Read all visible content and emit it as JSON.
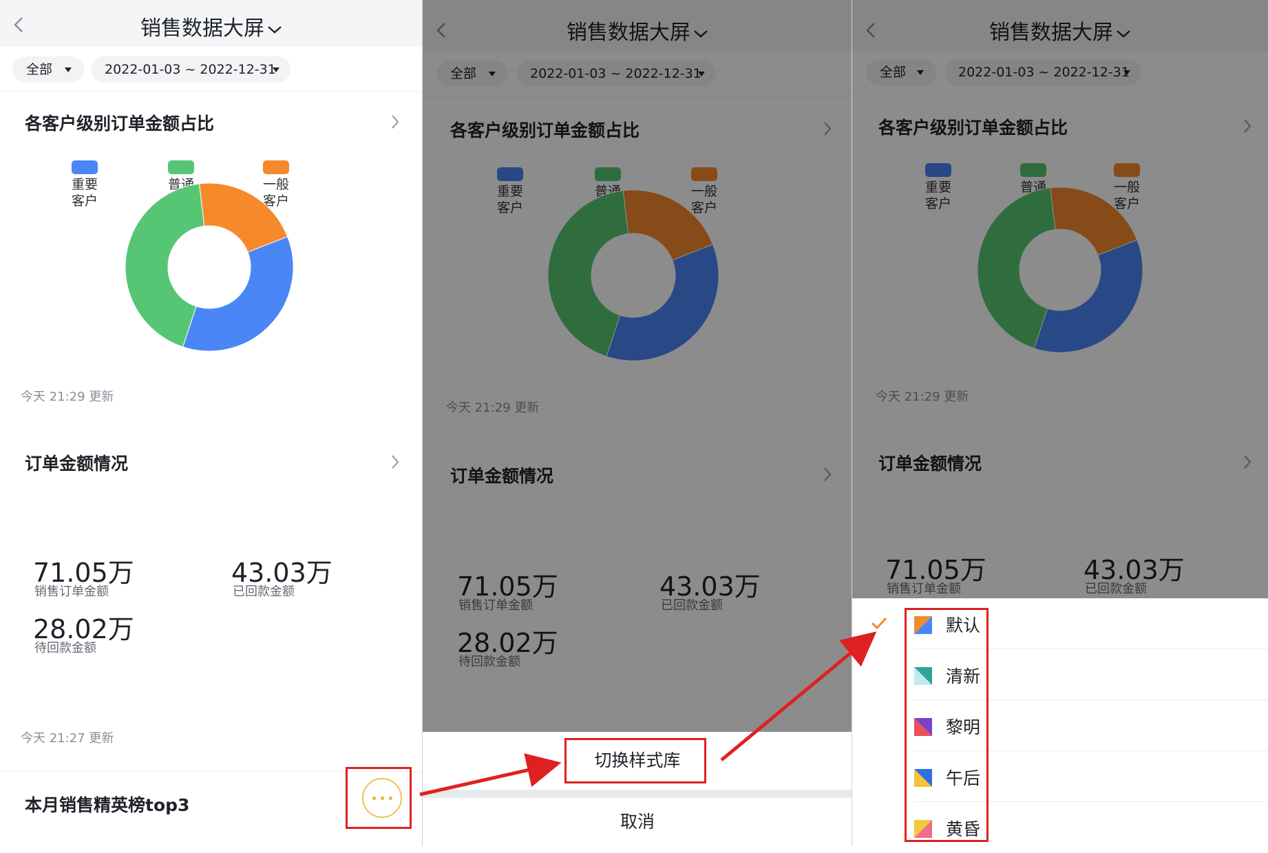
{
  "app": {
    "title": "销售数据大屏",
    "filter_scope": "全部",
    "filter_date_range": "2022-01-03 ~ 2022-12-31"
  },
  "cards": {
    "share": {
      "title": "各客户级别订单金额占比",
      "updated": "今天 21:29 更新"
    },
    "orders": {
      "title": "订单金额情况",
      "updated": "今天 21:27 更新",
      "metrics": [
        {
          "value": "71.05万",
          "label": "销售订单金额"
        },
        {
          "value": "43.03万",
          "label": "已回款金额"
        },
        {
          "value": "28.02万",
          "label": "待回款金额"
        }
      ]
    },
    "top3": {
      "title": "本月销售精英榜top3"
    }
  },
  "chart_data": {
    "type": "pie",
    "categories": [
      "重要客户",
      "普通客户",
      "一般客户"
    ],
    "values": [
      36,
      43,
      21
    ],
    "colors": [
      "#4a86f5",
      "#56c674",
      "#f5892c"
    ],
    "dark_colors": [
      "#1f3f8c",
      "#266a3c",
      "#8a4310"
    ],
    "legend_position": "top",
    "donut": true
  },
  "sheet": {
    "switch_style": "切换样式库",
    "cancel": "取消"
  },
  "styles": {
    "selected": "默认",
    "items": [
      {
        "label": "默认",
        "colors": [
          "#f5892c",
          "#4a86f5"
        ]
      },
      {
        "label": "清新",
        "colors": [
          "#2fa39a",
          "#bfeaf0"
        ]
      },
      {
        "label": "黎明",
        "colors": [
          "#7a42c9",
          "#ee4f5a"
        ]
      },
      {
        "label": "午后",
        "colors": [
          "#2f6fe0",
          "#f6c23a"
        ]
      },
      {
        "label": "黄昏",
        "colors": [
          "#f1c93a",
          "#f06c8a"
        ]
      }
    ]
  },
  "icons": {
    "back": "back-chevron-icon",
    "more": "more-dots-icon",
    "check": "check-icon"
  },
  "colors": {
    "annotation": "#e02020",
    "accent_check": "#f5892c"
  }
}
